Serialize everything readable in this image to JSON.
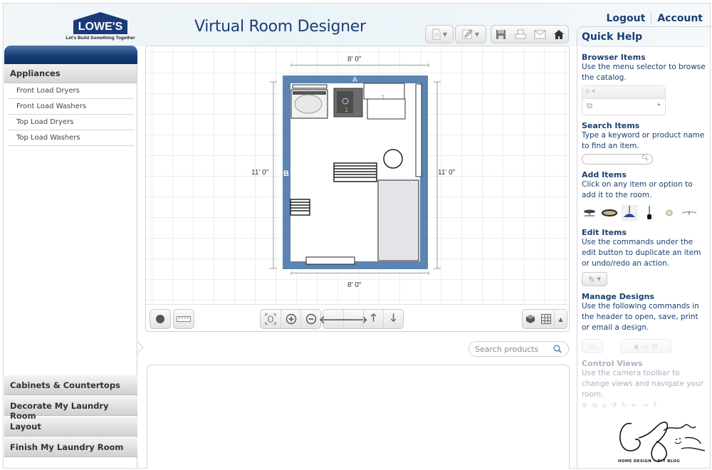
{
  "header": {
    "brand_name": "LOWE'S",
    "brand_tagline": "Let's Build Something Together",
    "app_title": "Virtual Room Designer",
    "links": [
      "Logout",
      "Account"
    ]
  },
  "toolbar": {
    "open_icon": "document-icon",
    "edit_icon": "pencil-icon",
    "save_icon": "floppy-icon",
    "print_icon": "printer-icon",
    "email_icon": "envelope-icon",
    "home_icon": "home-icon"
  },
  "sidebar": {
    "active_category": "Appliances",
    "subitems": [
      "Front Load Dryers",
      "Front Load Washers",
      "Top Load Dryers",
      "Top Load Washers"
    ],
    "other_categories": [
      "Cabinets & Countertops",
      "Decorate My Laundry Room",
      "Layout",
      "Finish My Laundry Room"
    ]
  },
  "floorplan": {
    "width_label": "8' 0\"",
    "height_label": "11' 0\"",
    "wall_labels": [
      "A",
      "B"
    ],
    "item_labels": [
      "1",
      "2"
    ],
    "wall_color": "#5b84b1"
  },
  "canvas_toolbar": {
    "left_buttons": [
      "record-icon",
      "ruler-icon"
    ],
    "zoom_buttons": [
      "fit-view-icon",
      "zoom-in-icon",
      "zoom-out-icon"
    ],
    "pan_buttons": [
      "arrow-left-icon",
      "arrow-right-icon",
      "arrow-up-icon",
      "arrow-down-icon"
    ],
    "view_buttons": [
      "3d-view-icon",
      "grid-view-icon",
      "collapse-icon"
    ]
  },
  "products": {
    "search_placeholder": "Search products"
  },
  "quick_help": {
    "title": "Quick Help",
    "sections": [
      {
        "title": "Browser Items",
        "text": "Use the menu selector to browse the catalog."
      },
      {
        "title": "Search Items",
        "text": "Type a keyword or product name to find an item."
      },
      {
        "title": "Add Items",
        "text": "Click on any item or option to add it to the room."
      },
      {
        "title": "Edit Items",
        "text": "Use the commands under the edit button to duplicate an item or undo/redo an action."
      },
      {
        "title": "Manage Designs",
        "text": "Use the following commands in the header to open, save, print or email a design."
      },
      {
        "title": "Control Views",
        "text": "Use the camera toolbar to change views and navigate your room."
      }
    ]
  },
  "watermark": {
    "tagline": "HOME DESIGN • DIY BLOG"
  }
}
